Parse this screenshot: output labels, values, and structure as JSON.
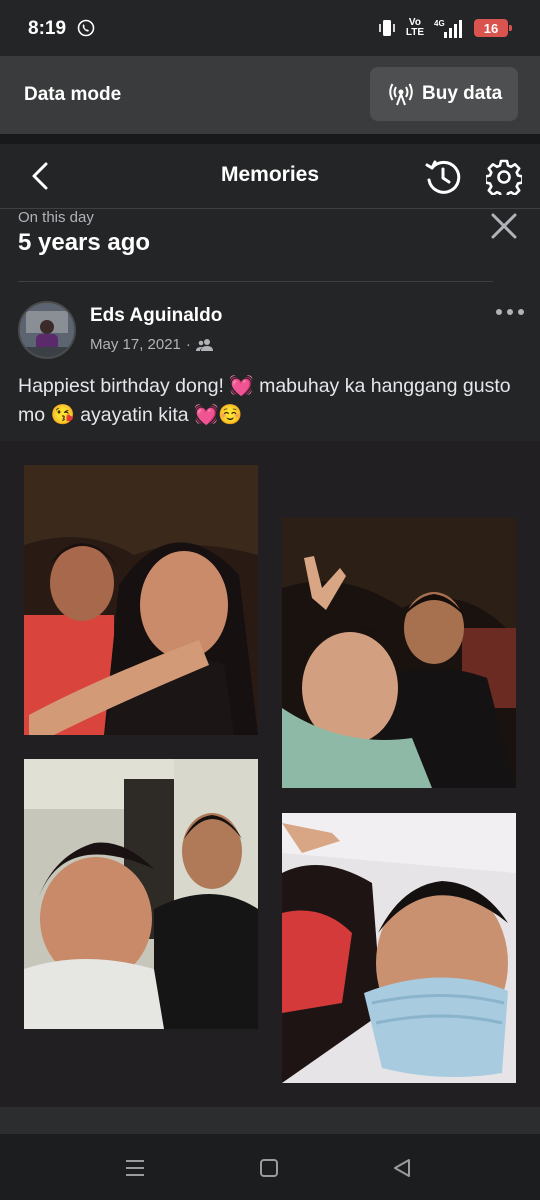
{
  "status": {
    "time": "8:19",
    "volte_top": "Vo",
    "volte_bottom": "LTE",
    "network": "4G",
    "battery": "16"
  },
  "data_mode": {
    "label": "Data mode",
    "button": "Buy data"
  },
  "header": {
    "title": "Memories"
  },
  "memory": {
    "subtitle": "On this day",
    "heading": "5 years ago"
  },
  "post": {
    "author": "Eds Aguinaldo",
    "date": "May 17, 2021",
    "separator": "·",
    "text": "Happiest birthday dong! 💓 mabuhay ka hanggang gusto mo 😘 ayayatin kita 💓☺️"
  },
  "colors": {
    "accent_battery": "#d9534f",
    "background": "#242526",
    "photo_bg": "#221f22"
  },
  "icons": [
    "viber-icon",
    "vibrate-icon",
    "signal-icon",
    "battery-icon",
    "broadcast-icon",
    "back-icon",
    "history-icon",
    "settings-icon",
    "close-icon",
    "friends-icon",
    "more-icon",
    "recents-icon",
    "home-icon",
    "back-nav-icon"
  ]
}
